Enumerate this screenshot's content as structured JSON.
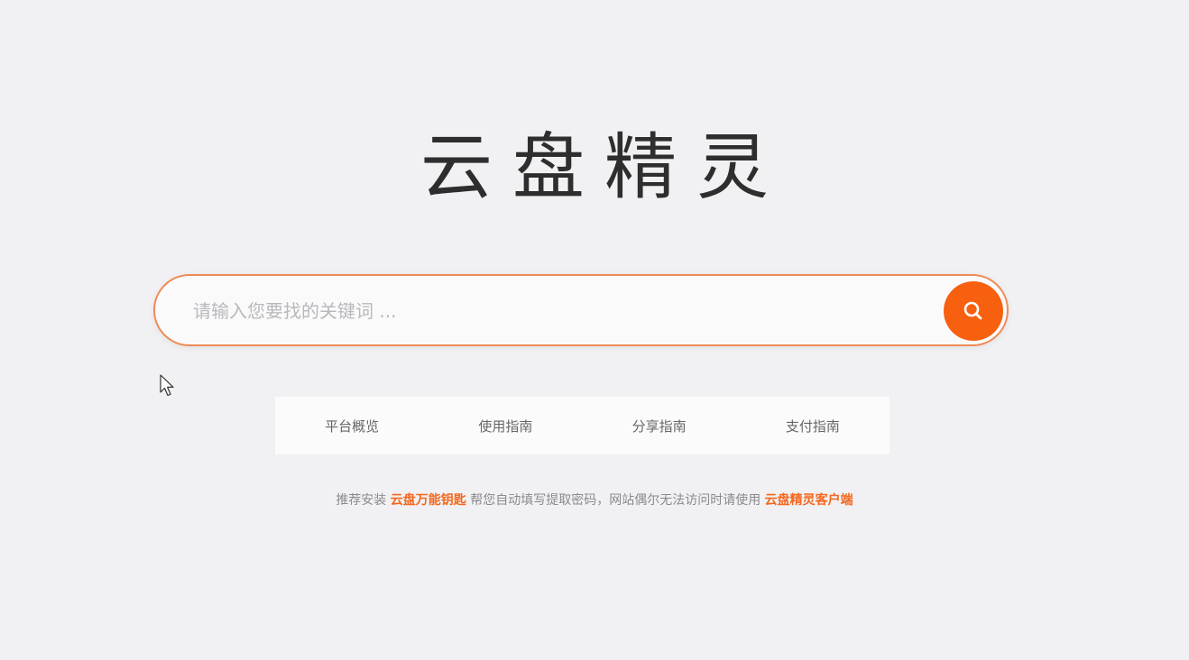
{
  "logo": {
    "title": "云盘精灵"
  },
  "search": {
    "placeholder": "请输入您要找的关键词 ...",
    "value": "",
    "button_icon": "search-icon"
  },
  "nav": {
    "items": [
      {
        "label": "平台概览"
      },
      {
        "label": "使用指南"
      },
      {
        "label": "分享指南"
      },
      {
        "label": "支付指南"
      }
    ]
  },
  "notice": {
    "prefix": "推荐安装",
    "link1": "云盘万能钥匙",
    "middle": "帮您自动填写提取密码，网站偶尔无法访问时请使用",
    "link2": "云盘精灵客户端"
  },
  "colors": {
    "accent": "#f7600f",
    "border": "#ef8a55",
    "background": "#f1f0f2"
  }
}
